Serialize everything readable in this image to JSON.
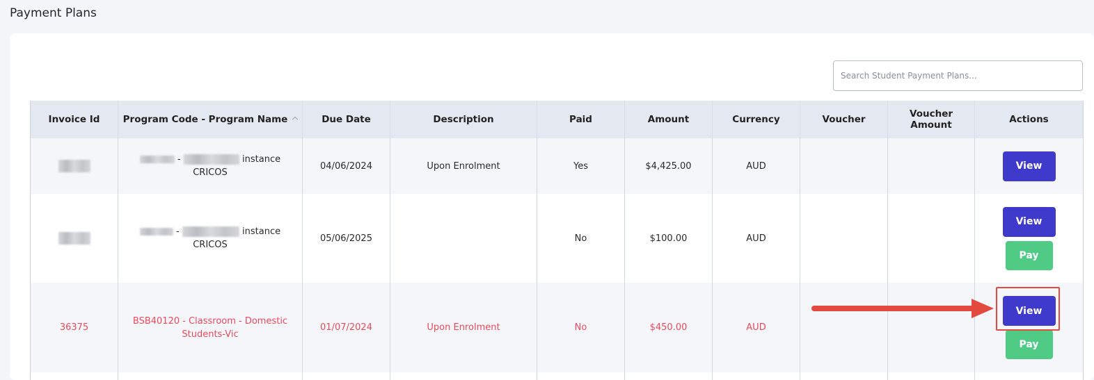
{
  "page": {
    "title": "Payment Plans"
  },
  "search": {
    "placeholder": "Search Student Payment Plans..."
  },
  "table": {
    "headers": [
      "Invoice Id",
      "Program Code - Program Name",
      "Due Date",
      "Description",
      "Paid",
      "Amount",
      "Currency",
      "Voucher",
      "Voucher Amount",
      "Actions"
    ],
    "rows": [
      {
        "invoice_id": "",
        "program_suffix": "instance",
        "program_line2": "CRICOS",
        "due_date": "04/06/2024",
        "description": "Upon Enrolment",
        "paid": "Yes",
        "amount": "$4,425.00",
        "currency": "AUD",
        "voucher": "",
        "voucher_amount": "",
        "view_label": "View"
      },
      {
        "invoice_id": "",
        "program_suffix": "instance",
        "program_line2": "CRICOS",
        "due_date": "05/06/2025",
        "description": "",
        "paid": "No",
        "amount": "$100.00",
        "currency": "AUD",
        "voucher": "",
        "voucher_amount": "",
        "view_label": "View",
        "pay_label": "Pay"
      },
      {
        "invoice_id": "36375",
        "program_line1": "BSB40120 - Classroom - Domestic",
        "program_line2": "Students-Vic",
        "due_date": "01/07/2024",
        "description": "Upon Enrolment",
        "paid": "No",
        "amount": "$450.00",
        "currency": "AUD",
        "voucher": "",
        "voucher_amount": "",
        "view_label": "View",
        "pay_label": "Pay"
      }
    ]
  },
  "colors": {
    "view_button": "#3f3acb",
    "pay_button": "#4fcb85",
    "overdue_text": "#e94a5c",
    "annotation": "#e24a3f"
  },
  "annotation": {
    "arrow_icon": "right-arrow-icon",
    "target": "view-button-row-3"
  }
}
